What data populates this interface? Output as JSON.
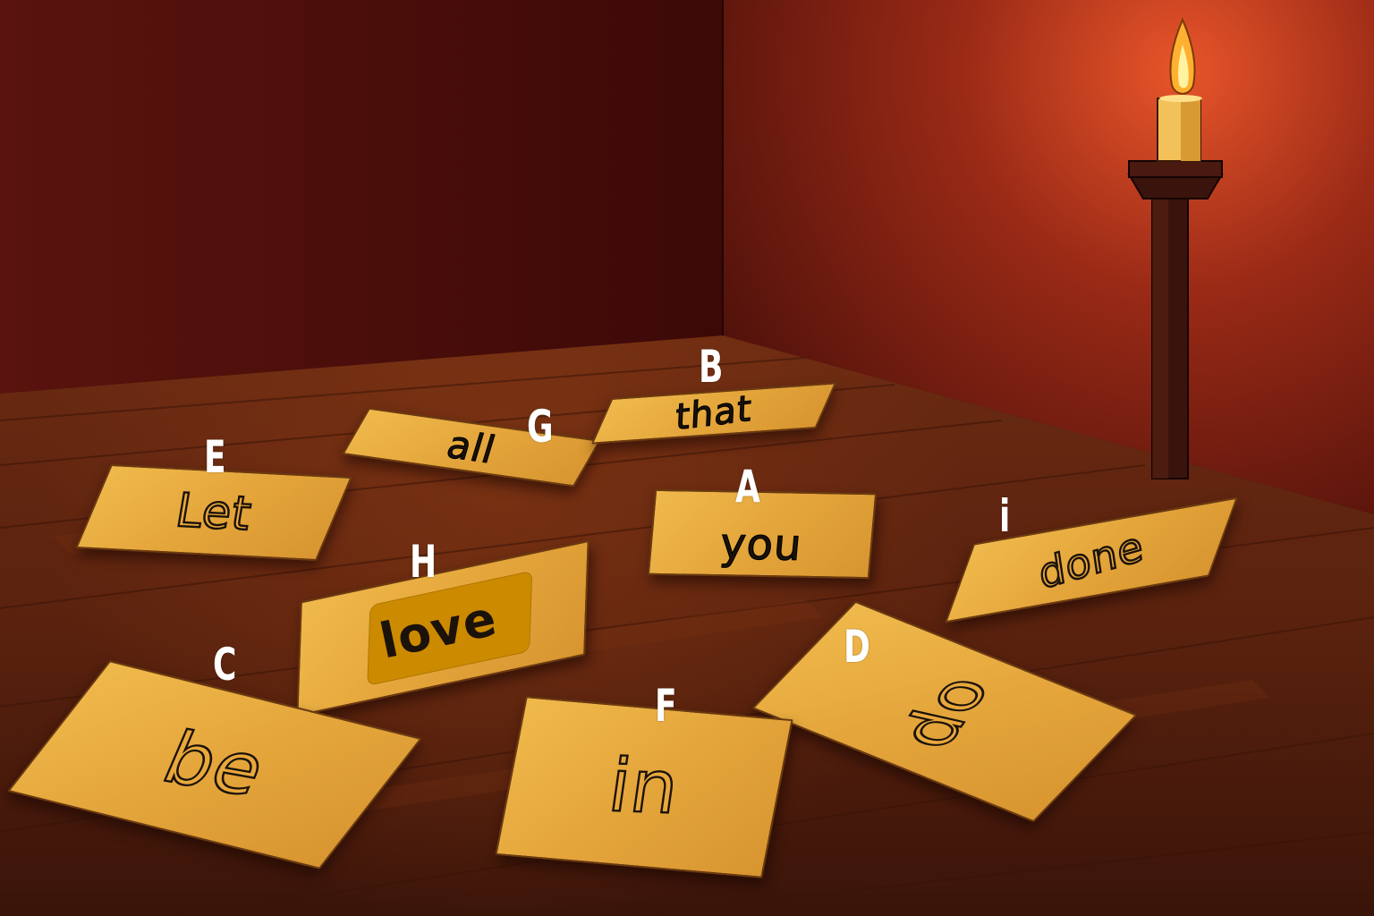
{
  "scene": {
    "description_colors": {
      "wall": "#4a0e0b",
      "floor": "#5a240f",
      "card": "#e8a83c",
      "highlight": "#cc8a00",
      "flame": "#ffc33a"
    }
  },
  "cards": [
    {
      "id": "A",
      "word": "you"
    },
    {
      "id": "B",
      "word": "that"
    },
    {
      "id": "C",
      "word": "be"
    },
    {
      "id": "D",
      "word": "do"
    },
    {
      "id": "E",
      "word": "Let"
    },
    {
      "id": "F",
      "word": "in"
    },
    {
      "id": "G",
      "word": "all"
    },
    {
      "id": "H",
      "word": "love",
      "selected": true
    },
    {
      "id": "i",
      "word": "done"
    }
  ],
  "labels": [
    "A",
    "B",
    "C",
    "D",
    "E",
    "F",
    "G",
    "H",
    "i"
  ]
}
